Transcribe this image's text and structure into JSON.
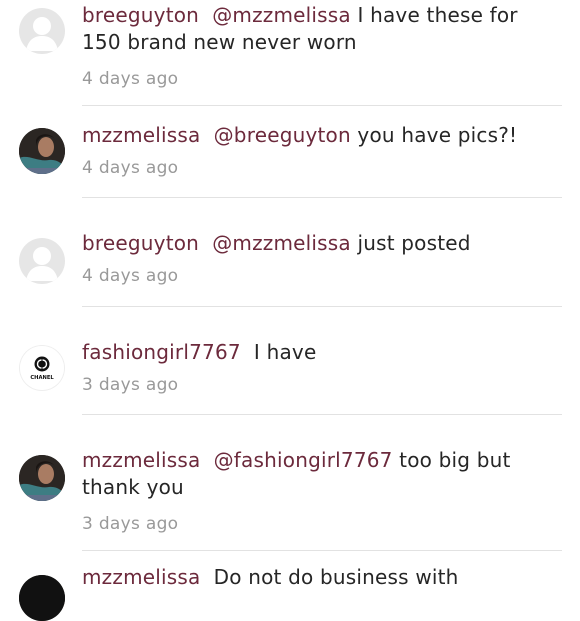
{
  "comments": [
    {
      "username": "breeguyton",
      "mention": "@mzzmelissa",
      "text": "I have these for 150 brand new never worn",
      "time": "4 days ago",
      "avatar": "default-avatar-icon"
    },
    {
      "username": "mzzmelissa",
      "mention": "@breeguyton",
      "text": "you have pics?!",
      "time": "4 days ago",
      "avatar": "photo"
    },
    {
      "username": "breeguyton",
      "mention": "@mzzmelissa",
      "text": "just posted",
      "time": "4 days ago",
      "avatar": "default-avatar-icon"
    },
    {
      "username": "fashiongirl7767",
      "mention": "",
      "text": "I have",
      "time": "3 days ago",
      "avatar": "chanel-logo",
      "avatar_text": "CHANEL"
    },
    {
      "username": "mzzmelissa",
      "mention": "@fashiongirl7767",
      "text": "too big but thank you",
      "time": "3 days ago",
      "avatar": "photo"
    },
    {
      "username": "mzzmelissa",
      "mention": "",
      "text": "Do not do business with",
      "time": "",
      "avatar": "photo"
    }
  ],
  "colors": {
    "username": "#6c2a3c",
    "text": "#262626",
    "timestamp": "#999999",
    "divider": "#e2e2e2"
  }
}
